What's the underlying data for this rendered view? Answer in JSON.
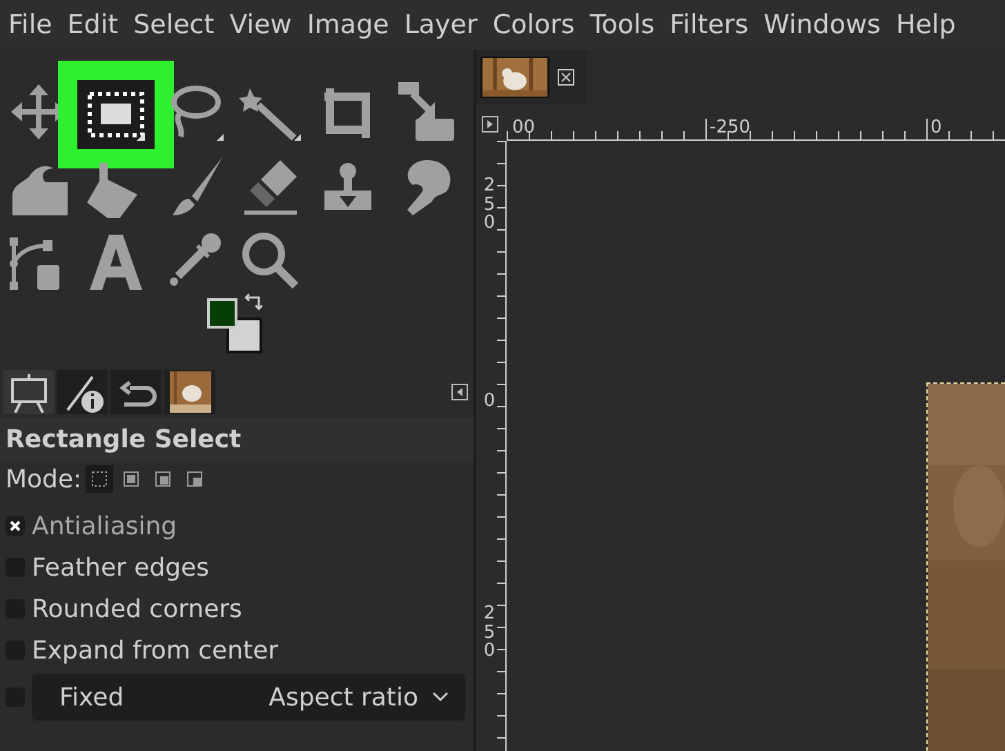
{
  "menu": [
    "File",
    "Edit",
    "Select",
    "View",
    "Image",
    "Layer",
    "Colors",
    "Tools",
    "Filters",
    "Windows",
    "Help"
  ],
  "tools": [
    {
      "kind": "move",
      "selected": false
    },
    {
      "kind": "rect-select",
      "selected": true
    },
    {
      "kind": "lasso",
      "selected": false
    },
    {
      "kind": "wand",
      "selected": false
    },
    {
      "kind": "crop",
      "selected": false
    },
    {
      "kind": "scale",
      "selected": false
    },
    {
      "kind": "warp",
      "selected": false
    },
    {
      "kind": "bucket",
      "selected": false
    },
    {
      "kind": "brush",
      "selected": false
    },
    {
      "kind": "eraser",
      "selected": false
    },
    {
      "kind": "stamp",
      "selected": false
    },
    {
      "kind": "smudge",
      "selected": false
    },
    {
      "kind": "paths",
      "selected": false
    },
    {
      "kind": "text",
      "selected": false
    },
    {
      "kind": "picker",
      "selected": false
    },
    {
      "kind": "zoom",
      "selected": false
    }
  ],
  "colors": [
    {
      "kind": "foreground",
      "color": "#063f06"
    },
    {
      "kind": "background",
      "color": "#d2d2d2"
    }
  ],
  "dock_tabs": [
    {
      "kind": "tool-options",
      "selected": true
    },
    {
      "kind": "pointer",
      "selected": false
    },
    {
      "kind": "undo",
      "selected": false
    },
    {
      "kind": "images",
      "selected": false
    }
  ],
  "tool_options": {
    "title": "Rectangle Select",
    "mode_label": "Mode:",
    "modes": [
      {
        "selected": true
      },
      {
        "selected": false
      },
      {
        "selected": false
      },
      {
        "selected": false
      }
    ],
    "checkboxes": [
      {
        "label": "Antialiasing",
        "checked": true
      },
      {
        "label": "Feather edges",
        "checked": false
      },
      {
        "label": "Rounded corners",
        "checked": false
      },
      {
        "label": "Expand from center",
        "checked": false
      }
    ],
    "fixed": {
      "checked": false,
      "label": "Fixed",
      "value": "Aspect ratio"
    }
  },
  "canvas": {
    "image_tab": {
      "kind": "picture"
    },
    "h_ruler": [
      "00",
      "-250",
      "0"
    ],
    "v_ruler": [
      "250",
      "0",
      "250"
    ]
  }
}
